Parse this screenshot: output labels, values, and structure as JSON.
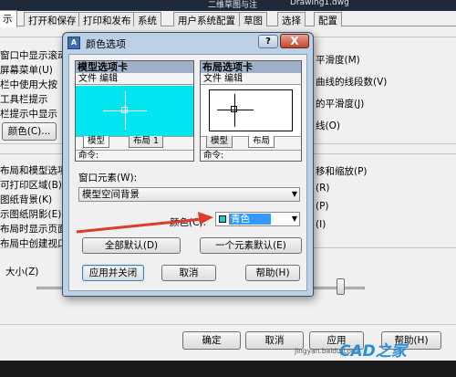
{
  "background_window": {
    "title_left": "二维草图与注",
    "title_file": "Drawing1.dwg",
    "tabs": [
      {
        "label": "示",
        "active": true
      },
      {
        "label": "打开和保存"
      },
      {
        "label": "打印和发布"
      },
      {
        "label": "系统"
      },
      {
        "label": "用户系统配置"
      },
      {
        "label": "草图"
      },
      {
        "label": "选择"
      },
      {
        "label": "配置"
      }
    ],
    "left_items": [
      "窗口中显示滚动",
      "屏幕菜单(U)",
      "栏中使用大按",
      "工具栏提示",
      "栏提示中显示"
    ],
    "colors_button": "颜色(C)...",
    "left_items2": [
      "布局和模型选项",
      "可打印区域(B)",
      "图纸背景(K)",
      "示图纸阴影(E)",
      "布局时显示页面",
      "布局中创建视口"
    ],
    "size_label": "大小(Z)",
    "right_items": [
      "平滑度(M)",
      "曲线的线段数(V)",
      "的平滑度(J)",
      "线(O)",
      "移和缩放(P)",
      "(R)",
      "(P)",
      "(I)"
    ],
    "buttons": {
      "ok": "确定",
      "cancel": "取消",
      "apply": "应用",
      "help": "帮助(H)"
    }
  },
  "color_dialog": {
    "title": "颜色选项",
    "help_symbol": "?",
    "close_symbol": "X",
    "model_preview": {
      "header": "模型选项卡",
      "menu": "文件 编辑",
      "tab_model": "模型",
      "tab_layout": "布局 1",
      "command": "命令:",
      "background": "#00e5f0"
    },
    "layout_preview": {
      "header": "布局选项卡",
      "menu": "文件 编辑",
      "tab_model": "模型",
      "tab_layout": "布局",
      "command": "命令:",
      "background": "#ffffff"
    },
    "window_element_label": "窗口元素(W):",
    "window_element_value": "模型空间背景",
    "color_label": "颜色(C):",
    "color_value": "青色",
    "color_swatch": "#00d7e3",
    "buttons": {
      "restore_all": "全部默认(D)",
      "restore_one": "一个元素默认(E)",
      "apply_close": "应用并关闭",
      "cancel": "取消",
      "help": "帮助(H)"
    }
  },
  "annotation": {
    "arrow_color": "#e03a2c"
  },
  "watermark": {
    "url": "jingyan.baidu.com",
    "logo": "CAD之家"
  }
}
